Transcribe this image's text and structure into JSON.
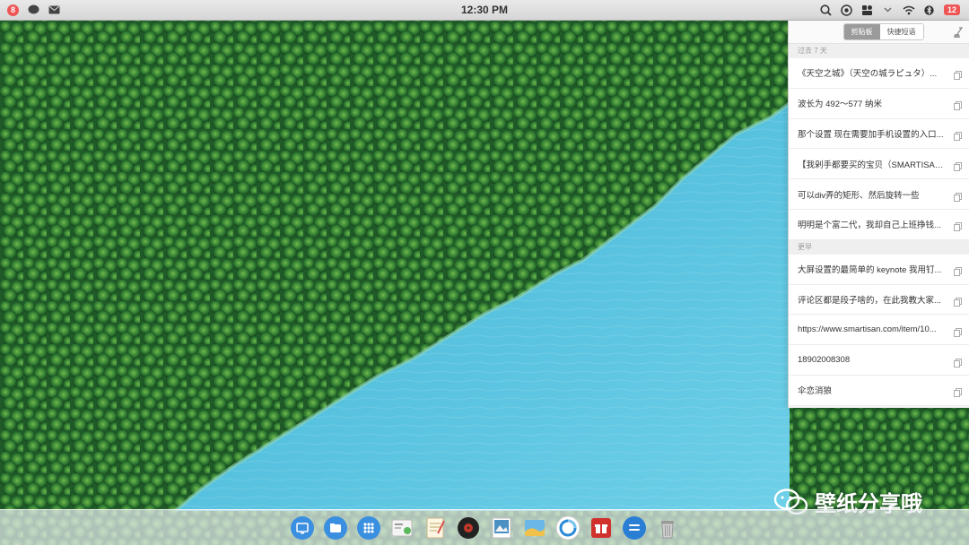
{
  "statusbar": {
    "clock": "12:30 PM",
    "left_badge": "8",
    "battery": "12"
  },
  "clipboard": {
    "tabs": [
      "剪贴板",
      "快捷短语"
    ],
    "active_tab": 0,
    "sections": [
      {
        "label": "过去 7 天",
        "items": [
          "《天空之城》（天空の城ラピュタ）...",
          "波长为 492～577 纳米",
          "那个设置 现在需要加手机设置的入口...",
          "【我剁手都要买的宝贝（SMARTISAN...",
          "可以div弄的矩形、然后旋转一些",
          "明明是个富二代，我却自己上班挣钱..."
        ]
      },
      {
        "label": "更早",
        "items": [
          "大屏设置的最简单的 keynote 我用钉...",
          "评论区都是段子啥的，在此我教大家...",
          "https://www.smartisan.com/item/10...",
          "18902008308",
          "伞恋消狼"
        ]
      }
    ]
  },
  "dock": {
    "icons": [
      "desktop-icon",
      "folder-icon",
      "launcher-icon",
      "id-card-icon",
      "notes-icon",
      "music-icon",
      "gallery-icon",
      "photos-icon",
      "browser-icon",
      "gift-icon",
      "messages-icon",
      "trash-icon"
    ]
  },
  "watermark": {
    "text": "壁纸分享哦"
  },
  "colors": {
    "water": "#54c4e0",
    "forest": "#2f7a32",
    "badge": "#e55555"
  }
}
